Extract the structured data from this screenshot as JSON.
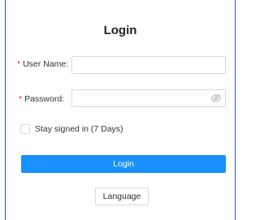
{
  "title": "Login",
  "form": {
    "username": {
      "required_mark": "*",
      "label": "User Name:",
      "value": "",
      "placeholder": ""
    },
    "password": {
      "required_mark": "*",
      "label": "Password:",
      "value": "",
      "placeholder": "",
      "visibility_icon": "eye-invisible-icon"
    },
    "stay_signed_in": {
      "label": "Stay signed in (7 Days)",
      "checked": false
    }
  },
  "buttons": {
    "login": "Login",
    "language": "Language"
  },
  "colors": {
    "primary": "#1890ff",
    "required": "#f5222d",
    "border": "#d9d9d9",
    "frame": "#1f5fb0"
  }
}
